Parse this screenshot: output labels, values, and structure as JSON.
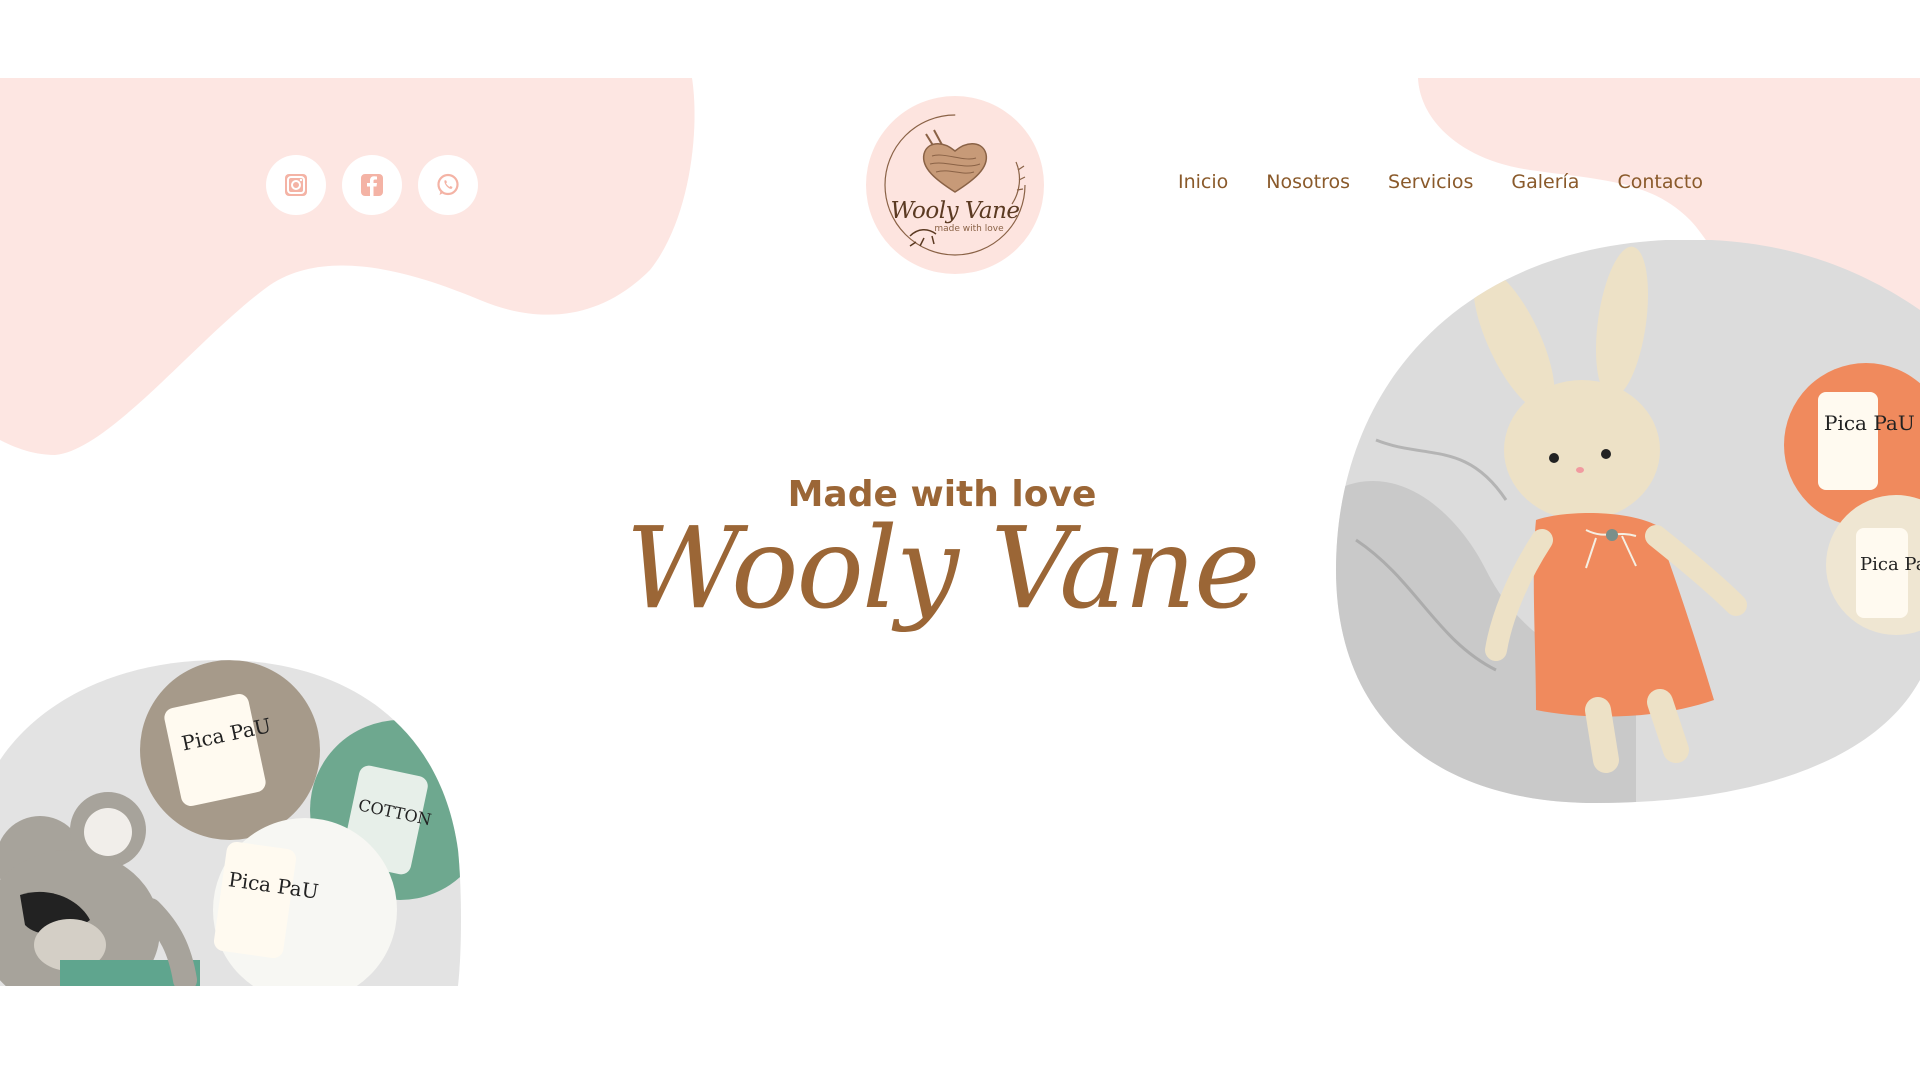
{
  "brand": {
    "logo_name": "Wooly Vane",
    "logo_tagline": "made with love",
    "colors": {
      "accent": "#9b6636",
      "blob": "#fde6e2",
      "nav_text": "#8a5a2b",
      "icon": "#f4b3a5"
    }
  },
  "social": [
    {
      "name": "instagram",
      "icon": "instagram-icon"
    },
    {
      "name": "facebook",
      "icon": "facebook-icon"
    },
    {
      "name": "whatsapp",
      "icon": "whatsapp-icon"
    }
  ],
  "nav": {
    "items": [
      "Inicio",
      "Nosotros",
      "Servicios",
      "Galería",
      "Contacto"
    ]
  },
  "hero": {
    "subtitle": "Made with love",
    "title": "Wooly Vane"
  },
  "photos": {
    "left": {
      "yarn_labels": [
        "Pica PaU",
        "Pica PaU",
        "COTTON"
      ]
    },
    "right": {
      "yarn_labels": [
        "Pica PaU",
        "Pica PaU"
      ]
    }
  }
}
